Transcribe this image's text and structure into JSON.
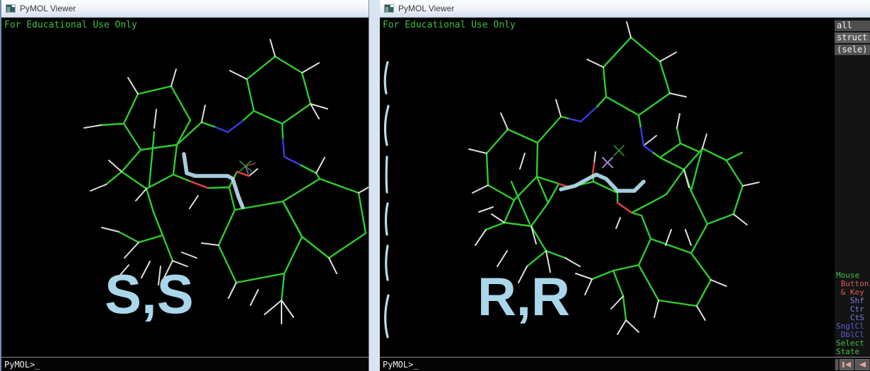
{
  "left_window": {
    "title": "PyMOL Viewer",
    "watermark": "For Educational Use Only",
    "stereo_label": "S,S",
    "prompt": "PyMOL>_"
  },
  "right_window": {
    "title": "PyMOL Viewer",
    "watermark": "For Educational Use Only",
    "stereo_label": "R,R",
    "prompt": "PyMOL>_"
  },
  "object_panel": {
    "items": [
      "all",
      "struct",
      "(sele)"
    ]
  },
  "mouse_panel": {
    "lines": [
      {
        "text": "Mouse",
        "css": "color:#42bd42"
      },
      {
        "text": " Button",
        "css": "color:#d95c5c"
      },
      {
        "text": " & Key",
        "css": "color:#d95c5c"
      },
      {
        "text": "   Shf",
        "css": "color:#7d7de0"
      },
      {
        "text": "   Ctr",
        "css": "color:#7d7de0"
      },
      {
        "text": "   CtS",
        "css": "color:#7d7de0"
      },
      {
        "text": "SnglCl",
        "css": "color:#5c5ce0"
      },
      {
        "text": " DblCl",
        "css": "color:#5c5ce0"
      },
      {
        "text": "Select",
        "css": "color:#42bd42"
      },
      {
        "text": "State",
        "css": "color:#42bd42"
      }
    ]
  },
  "movie_controls": {
    "buttons": [
      "skip-to-start",
      "step-back"
    ]
  },
  "colors": {
    "carbon_bond": "#2ecc2e",
    "hydrogen_bond": "#dfdfdf",
    "nitrogen_bond": "#3a3ae0",
    "oxygen_bond": "#d94040",
    "selection_highlight": "#b5ddee",
    "stereo_label": "#a9d6ea",
    "watermark_green": "#42bd42",
    "panel_row_gray": "#4e4e4e"
  }
}
